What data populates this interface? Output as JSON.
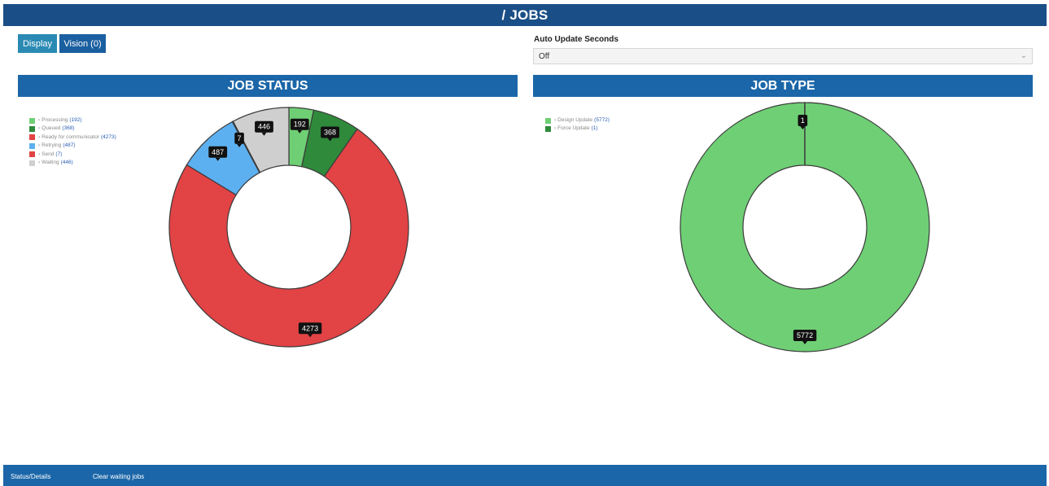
{
  "header": {
    "title": "/ JOBS"
  },
  "buttons": {
    "display": "Display",
    "vision": "Vision (0)"
  },
  "auto_update": {
    "label": "Auto Update Seconds",
    "value": "Off"
  },
  "footer": {
    "status_details": "Status/Details",
    "clear_waiting": "Clear waiting jobs"
  },
  "chart_data": [
    {
      "type": "pie",
      "title": "JOB STATUS",
      "legend": "top-left",
      "slices": [
        {
          "label": "Processing",
          "value": 192,
          "color": "#6fcf75",
          "count_text": "(192)",
          "data_label": "192"
        },
        {
          "label": "Queued",
          "value": 368,
          "color": "#2f8a3b",
          "count_text": "(368)",
          "data_label": "368"
        },
        {
          "label": "Ready for communicator",
          "value": 4273,
          "color": "#e24345",
          "count_text": "(4273)",
          "data_label": "4273"
        },
        {
          "label": "Retrying",
          "value": 487,
          "color": "#5db0f0",
          "count_text": "(487)",
          "data_label": "487"
        },
        {
          "label": "Send",
          "value": 7,
          "color": "#e24345",
          "count_text": "(7)",
          "data_label": "7"
        },
        {
          "label": "Waiting",
          "value": 446,
          "color": "#cfcfcf",
          "count_text": "(446)",
          "data_label": "446"
        }
      ]
    },
    {
      "type": "pie",
      "title": "JOB TYPE",
      "legend": "top-left",
      "slices": [
        {
          "label": "Design Update",
          "value": 5772,
          "color": "#6fcf75",
          "count_text": "(5772)",
          "data_label": "5772"
        },
        {
          "label": "Force Update",
          "value": 1,
          "color": "#2f8a3b",
          "count_text": "(1)",
          "data_label": "1"
        }
      ]
    }
  ]
}
